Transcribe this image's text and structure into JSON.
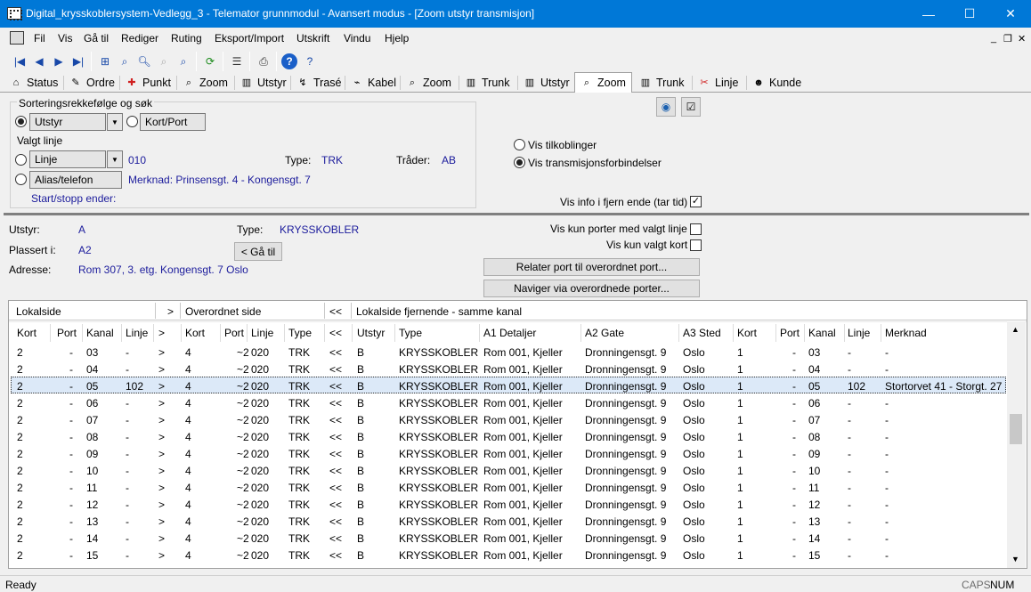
{
  "window": {
    "title": "Digital_krysskoblersystem-Vedlegg_3 - Telemator grunnmodul - Avansert modus - [Zoom utstyr transmisjon]",
    "min": "—",
    "max": "☐",
    "close": "✕"
  },
  "menu": [
    "Fil",
    "Vis",
    "Gå til",
    "Rediger",
    "Ruting",
    "Eksport/Import",
    "Utskrift",
    "Vindu",
    "Hjelp"
  ],
  "mdi": {
    "min": "_",
    "restore": "❐",
    "close": "✕"
  },
  "toolbar": [
    "first-icon",
    "prev-icon",
    "next-icon",
    "last-icon",
    "tree-icon",
    "zoom-icon",
    "search-icon",
    "zoom-disabled-icon",
    "find-icon",
    "refresh-icon",
    "list-icon",
    "print-icon",
    "help-icon",
    "context-help-icon"
  ],
  "tabs": [
    {
      "label": "Status",
      "icon": "⌂"
    },
    {
      "label": "Ordre",
      "icon": "✎"
    },
    {
      "label": "Punkt",
      "icon": "✚"
    },
    {
      "label": "Zoom",
      "icon": "⌕"
    },
    {
      "label": "Utstyr",
      "icon": "▥"
    },
    {
      "label": "Trasé",
      "icon": "↯"
    },
    {
      "label": "Kabel",
      "icon": "⌁"
    },
    {
      "label": "Zoom",
      "icon": "⌕"
    },
    {
      "label": "Trunk",
      "icon": "▥"
    },
    {
      "label": "Utstyr",
      "icon": "▥"
    },
    {
      "label": "Zoom",
      "icon": "⌕"
    },
    {
      "label": "Trunk",
      "icon": "▥"
    },
    {
      "label": "Linje",
      "icon": "✂"
    },
    {
      "label": "Kunde",
      "icon": "☻"
    }
  ],
  "sort": {
    "heading": "Sorteringsrekkefølge og søk",
    "opt_utstyr": "Utstyr",
    "opt_kortport": "Kort/Port",
    "valgt_linje": "Valgt linje",
    "opt_linje": "Linje",
    "linje_value": "010",
    "type_label": "Type:",
    "type_value": "TRK",
    "trader_label": "Tråder:",
    "trader_value": "AB",
    "opt_alias": "Alias/telefon",
    "merknad": "Merknad: Prinsensgt. 4 - Kongensgt. 7",
    "start_stopp": "Start/stopp ender:"
  },
  "view": {
    "vis_tilkoblinger": "Vis tilkoblinger",
    "vis_transmisjon": "Vis transmisjonsforbindelser",
    "vis_info": "Vis info i fjern ende (tar tid)",
    "vis_info_checked": "✓"
  },
  "equip": {
    "utstyr_label": "Utstyr:",
    "utstyr_value": "A",
    "type_label": "Type:",
    "type_value": "KRYSSKOBLER",
    "plassert_label": "Plassert i:",
    "plassert_value": "A2",
    "goto_button": "< Gå til",
    "adresse_label": "Adresse:",
    "adresse_value": "Rom 307, 3. etg. Kongensgt. 7 Oslo",
    "vis_kun_porter": "Vis kun porter med valgt linje",
    "vis_kun_kort": "Vis kun valgt kort",
    "relater_button": "Relater port til overordnet port...",
    "naviger_button": "Naviger via overordnede porter..."
  },
  "grid": {
    "groups": [
      "Lokalside",
      ">",
      "Overordnet side",
      "<<",
      "Lokalside fjernende - samme kanal"
    ],
    "columns": [
      "Kort",
      "Port",
      "Kanal",
      "Linje",
      ">",
      "Kort",
      "Port",
      "Linje",
      "Type",
      "<<",
      "Utstyr",
      "Type",
      "A1 Detaljer",
      "A2 Gate",
      "A3 Sted",
      "Kort",
      "Port",
      "Kanal",
      "Linje",
      "Merknad"
    ],
    "rows": [
      [
        "2",
        "-",
        "03",
        "-",
        ">",
        "4",
        "~2",
        "020",
        "TRK",
        "<<",
        "B",
        "KRYSSKOBLER",
        "Rom 001, Kjeller",
        "Dronningensgt. 9",
        "Oslo",
        "1",
        "-",
        "03",
        "-",
        "-"
      ],
      [
        "2",
        "-",
        "04",
        "-",
        ">",
        "4",
        "~2",
        "020",
        "TRK",
        "<<",
        "B",
        "KRYSSKOBLER",
        "Rom 001, Kjeller",
        "Dronningensgt. 9",
        "Oslo",
        "1",
        "-",
        "04",
        "-",
        "-"
      ],
      [
        "2",
        "-",
        "05",
        "102",
        ">",
        "4",
        "~2",
        "020",
        "TRK",
        "<<",
        "B",
        "KRYSSKOBLER",
        "Rom 001, Kjeller",
        "Dronningensgt. 9",
        "Oslo",
        "1",
        "-",
        "05",
        "102",
        "Stortorvet 41 - Storgt. 27"
      ],
      [
        "2",
        "-",
        "06",
        "-",
        ">",
        "4",
        "~2",
        "020",
        "TRK",
        "<<",
        "B",
        "KRYSSKOBLER",
        "Rom 001, Kjeller",
        "Dronningensgt. 9",
        "Oslo",
        "1",
        "-",
        "06",
        "-",
        "-"
      ],
      [
        "2",
        "-",
        "07",
        "-",
        ">",
        "4",
        "~2",
        "020",
        "TRK",
        "<<",
        "B",
        "KRYSSKOBLER",
        "Rom 001, Kjeller",
        "Dronningensgt. 9",
        "Oslo",
        "1",
        "-",
        "07",
        "-",
        "-"
      ],
      [
        "2",
        "-",
        "08",
        "-",
        ">",
        "4",
        "~2",
        "020",
        "TRK",
        "<<",
        "B",
        "KRYSSKOBLER",
        "Rom 001, Kjeller",
        "Dronningensgt. 9",
        "Oslo",
        "1",
        "-",
        "08",
        "-",
        "-"
      ],
      [
        "2",
        "-",
        "09",
        "-",
        ">",
        "4",
        "~2",
        "020",
        "TRK",
        "<<",
        "B",
        "KRYSSKOBLER",
        "Rom 001, Kjeller",
        "Dronningensgt. 9",
        "Oslo",
        "1",
        "-",
        "09",
        "-",
        "-"
      ],
      [
        "2",
        "-",
        "10",
        "-",
        ">",
        "4",
        "~2",
        "020",
        "TRK",
        "<<",
        "B",
        "KRYSSKOBLER",
        "Rom 001, Kjeller",
        "Dronningensgt. 9",
        "Oslo",
        "1",
        "-",
        "10",
        "-",
        "-"
      ],
      [
        "2",
        "-",
        "11",
        "-",
        ">",
        "4",
        "~2",
        "020",
        "TRK",
        "<<",
        "B",
        "KRYSSKOBLER",
        "Rom 001, Kjeller",
        "Dronningensgt. 9",
        "Oslo",
        "1",
        "-",
        "11",
        "-",
        "-"
      ],
      [
        "2",
        "-",
        "12",
        "-",
        ">",
        "4",
        "~2",
        "020",
        "TRK",
        "<<",
        "B",
        "KRYSSKOBLER",
        "Rom 001, Kjeller",
        "Dronningensgt. 9",
        "Oslo",
        "1",
        "-",
        "12",
        "-",
        "-"
      ],
      [
        "2",
        "-",
        "13",
        "-",
        ">",
        "4",
        "~2",
        "020",
        "TRK",
        "<<",
        "B",
        "KRYSSKOBLER",
        "Rom 001, Kjeller",
        "Dronningensgt. 9",
        "Oslo",
        "1",
        "-",
        "13",
        "-",
        "-"
      ],
      [
        "2",
        "-",
        "14",
        "-",
        ">",
        "4",
        "~2",
        "020",
        "TRK",
        "<<",
        "B",
        "KRYSSKOBLER",
        "Rom 001, Kjeller",
        "Dronningensgt. 9",
        "Oslo",
        "1",
        "-",
        "14",
        "-",
        "-"
      ],
      [
        "2",
        "-",
        "15",
        "-",
        ">",
        "4",
        "~2",
        "020",
        "TRK",
        "<<",
        "B",
        "KRYSSKOBLER",
        "Rom 001, Kjeller",
        "Dronningensgt. 9",
        "Oslo",
        "1",
        "-",
        "15",
        "-",
        "-"
      ]
    ],
    "selected_row": 2
  },
  "status": {
    "text": "Ready",
    "caps": "CAPS",
    "num": "NUM"
  }
}
